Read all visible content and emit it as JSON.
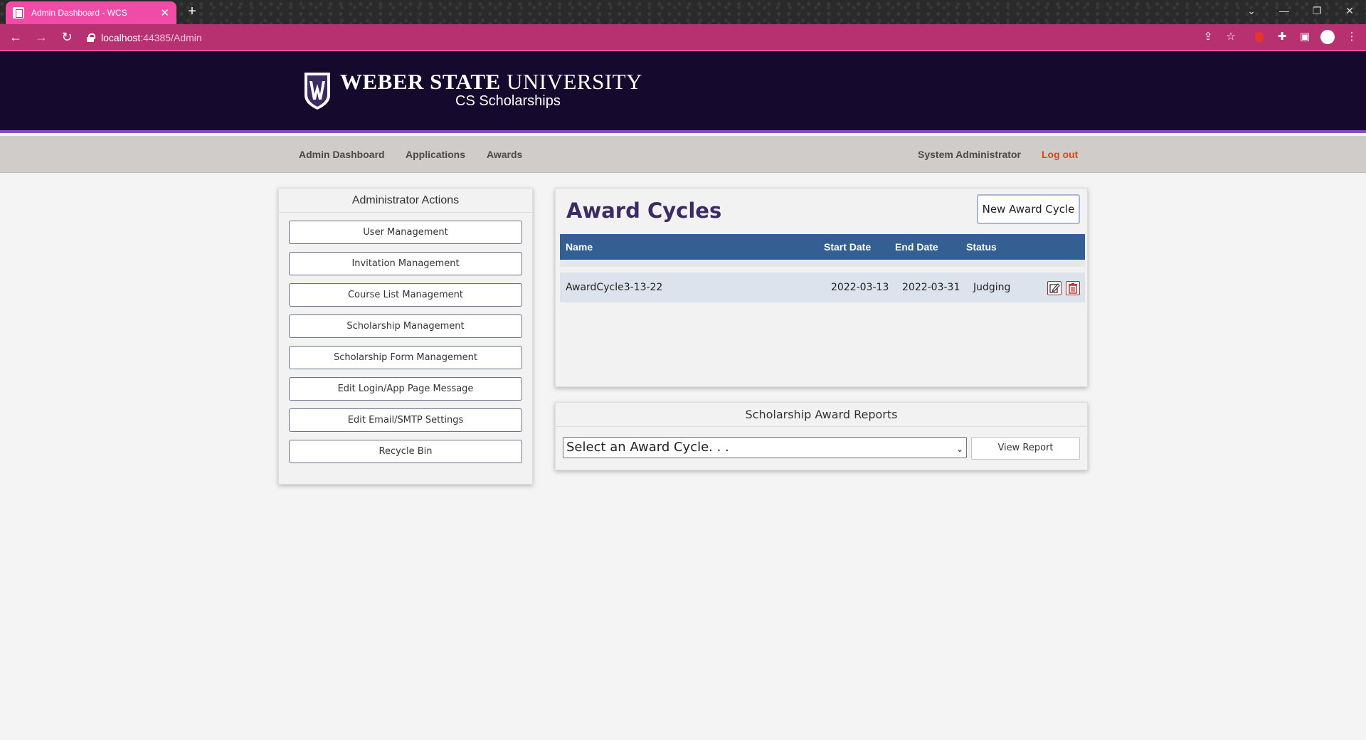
{
  "browser": {
    "tab_title": "Admin Dashboard - WCS",
    "url_host": "localhost",
    "url_rest": ":44385/Admin"
  },
  "site": {
    "brand_strong": "WEBER STATE",
    "brand_light": " UNIVERSITY",
    "brand_sub": "CS Scholarships"
  },
  "nav": {
    "items": [
      "Admin Dashboard",
      "Applications",
      "Awards"
    ],
    "user": "System Administrator",
    "logout": "Log out"
  },
  "admin_actions": {
    "title": "Administrator Actions",
    "buttons": [
      "User Management",
      "Invitation Management",
      "Course List Management",
      "Scholarship Management",
      "Scholarship Form Management",
      "Edit Login/App Page Message",
      "Edit Email/SMTP Settings",
      "Recycle Bin"
    ]
  },
  "award_cycles": {
    "title": "Award Cycles",
    "new_button": "New Award Cycle",
    "columns": [
      "Name",
      "Start Date",
      "End Date",
      "Status"
    ],
    "rows": [
      {
        "name": "AwardCycle3-13-22",
        "start": "2022-03-13",
        "end": "2022-03-31",
        "status": "Judging"
      }
    ]
  },
  "reports": {
    "title": "Scholarship Award Reports",
    "select_value": "Select an Award Cycle. . .",
    "view_button": "View Report"
  },
  "colors": {
    "header_bg": "#150a2e",
    "accent_purple": "#8a4fc7",
    "table_head": "#335f93",
    "logout": "#e0451c",
    "browser_accent": "#b7306f"
  }
}
